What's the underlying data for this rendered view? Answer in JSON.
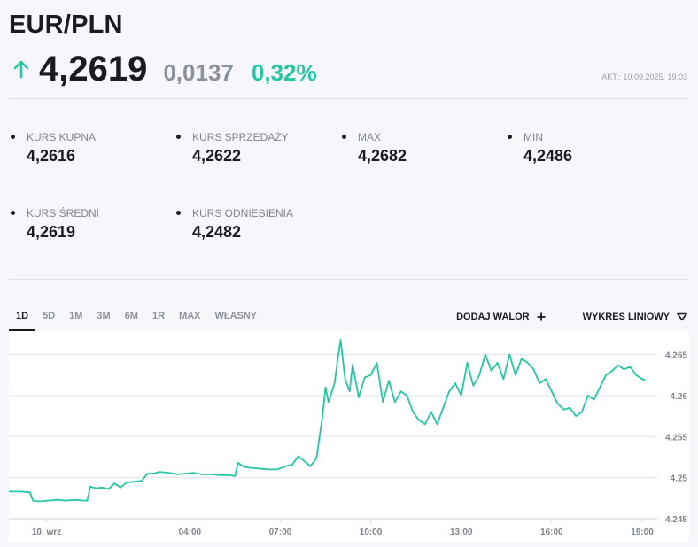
{
  "header": {
    "title": "EUR/PLN",
    "price": "4,2619",
    "change": "0,0137",
    "change_pct": "0,32%",
    "updated": "AKT.: 10.09.2025, 19:03",
    "direction_icon": "arrow-up-icon",
    "accent_color": "#23c7a4"
  },
  "stats": [
    {
      "label": "KURS KUPNA",
      "value": "4,2616"
    },
    {
      "label": "KURS SPRZEDAŻY",
      "value": "4,2622"
    },
    {
      "label": "MAX",
      "value": "4,2682"
    },
    {
      "label": "MIN",
      "value": "4,2486"
    },
    {
      "label": "KURS ŚREDNI",
      "value": "4,2619"
    },
    {
      "label": "KURS ODNIESIENIA",
      "value": "4,2482"
    }
  ],
  "tabs": [
    "1D",
    "5D",
    "1M",
    "3M",
    "6M",
    "1R",
    "MAX",
    "WŁASNY"
  ],
  "active_tab": "1D",
  "tools": {
    "add_label": "DODAJ WALOR",
    "add_icon": "plus-icon",
    "chart_type_label": "WYKRES LINIOWY",
    "chart_type_icon": "triangle-down-icon"
  },
  "chart_data": {
    "type": "line",
    "title": "",
    "xlabel": "",
    "ylabel": "",
    "y_axis_position": "right",
    "ylim": [
      4.245,
      4.267
    ],
    "xlim": [
      0,
      21.5
    ],
    "grid": "horizontal",
    "line_color": "#23c7a4",
    "x_ticks": [
      {
        "x": 1.25,
        "label": "10. wrz"
      },
      {
        "x": 6,
        "label": "04:00"
      },
      {
        "x": 9,
        "label": "07:00"
      },
      {
        "x": 12,
        "label": "10:00"
      },
      {
        "x": 15,
        "label": "13:00"
      },
      {
        "x": 18,
        "label": "16:00"
      },
      {
        "x": 21,
        "label": "19:00"
      }
    ],
    "y_ticks": [
      {
        "y": 4.245,
        "label": "4.245"
      },
      {
        "y": 4.25,
        "label": "4.25"
      },
      {
        "y": 4.255,
        "label": "4.255"
      },
      {
        "y": 4.26,
        "label": "4.26"
      },
      {
        "y": 4.265,
        "label": "4.265"
      }
    ],
    "series": [
      {
        "x": [
          0,
          0.4,
          0.7,
          0.8,
          1.0,
          1.3,
          1.6,
          1.9,
          2.2,
          2.5,
          2.6,
          2.7,
          2.9,
          3.1,
          3.3,
          3.5,
          3.7,
          3.9,
          4.1,
          4.4,
          4.6,
          4.8,
          5.0,
          5.3,
          5.6,
          5.9,
          6.1,
          6.4,
          6.7,
          7.0,
          7.3,
          7.5,
          7.6,
          7.8,
          8.0,
          8.3,
          8.6,
          8.9,
          9.2,
          9.4,
          9.6,
          9.8,
          10.0,
          10.2,
          10.4,
          10.5,
          10.6,
          10.8,
          10.9,
          11.0,
          11.15,
          11.3,
          11.4,
          11.6,
          11.8,
          12.0,
          12.2,
          12.4,
          12.6,
          12.8,
          13.0,
          13.2,
          13.4,
          13.6,
          13.8,
          14.0,
          14.2,
          14.4,
          14.6,
          14.8,
          15.0,
          15.2,
          15.4,
          15.6,
          15.8,
          16.0,
          16.2,
          16.4,
          16.6,
          16.8,
          17.0,
          17.2,
          17.4,
          17.6,
          17.8,
          18.0,
          18.2,
          18.4,
          18.6,
          18.8,
          19.0,
          19.2,
          19.4,
          19.6,
          19.8,
          20.0,
          20.2,
          20.4,
          20.6,
          20.8,
          21.0,
          21.1
        ],
        "y": [
          4.2483,
          4.2483,
          4.2482,
          4.2472,
          4.2471,
          4.2472,
          4.2473,
          4.2472,
          4.2473,
          4.2472,
          4.2472,
          4.2489,
          4.2487,
          4.2488,
          4.2486,
          4.2493,
          4.2488,
          4.2494,
          4.2495,
          4.2496,
          4.2505,
          4.2505,
          4.2507,
          4.2506,
          4.2504,
          4.2505,
          4.2506,
          4.2504,
          4.2504,
          4.2503,
          4.2503,
          4.2502,
          4.2518,
          4.2513,
          4.2512,
          4.2511,
          4.251,
          4.251,
          4.2514,
          4.2516,
          4.2526,
          4.252,
          4.2514,
          4.2524,
          4.2575,
          4.261,
          4.2592,
          4.2615,
          4.2643,
          4.2668,
          4.262,
          4.2605,
          4.2638,
          4.2598,
          4.2622,
          4.2625,
          4.264,
          4.2592,
          4.2618,
          4.2592,
          4.2605,
          4.26,
          4.258,
          4.257,
          4.2565,
          4.258,
          4.2565,
          4.2585,
          4.2605,
          4.2615,
          4.26,
          4.264,
          4.2612,
          4.2625,
          4.265,
          4.263,
          4.264,
          4.262,
          4.265,
          4.2625,
          4.2645,
          4.264,
          4.2632,
          4.2615,
          4.262,
          4.2605,
          4.259,
          4.2583,
          4.2585,
          4.2575,
          4.258,
          4.26,
          4.2595,
          4.261,
          4.2625,
          4.263,
          4.2637,
          4.2632,
          4.2635,
          4.2625,
          4.262,
          4.2619
        ]
      }
    ]
  }
}
